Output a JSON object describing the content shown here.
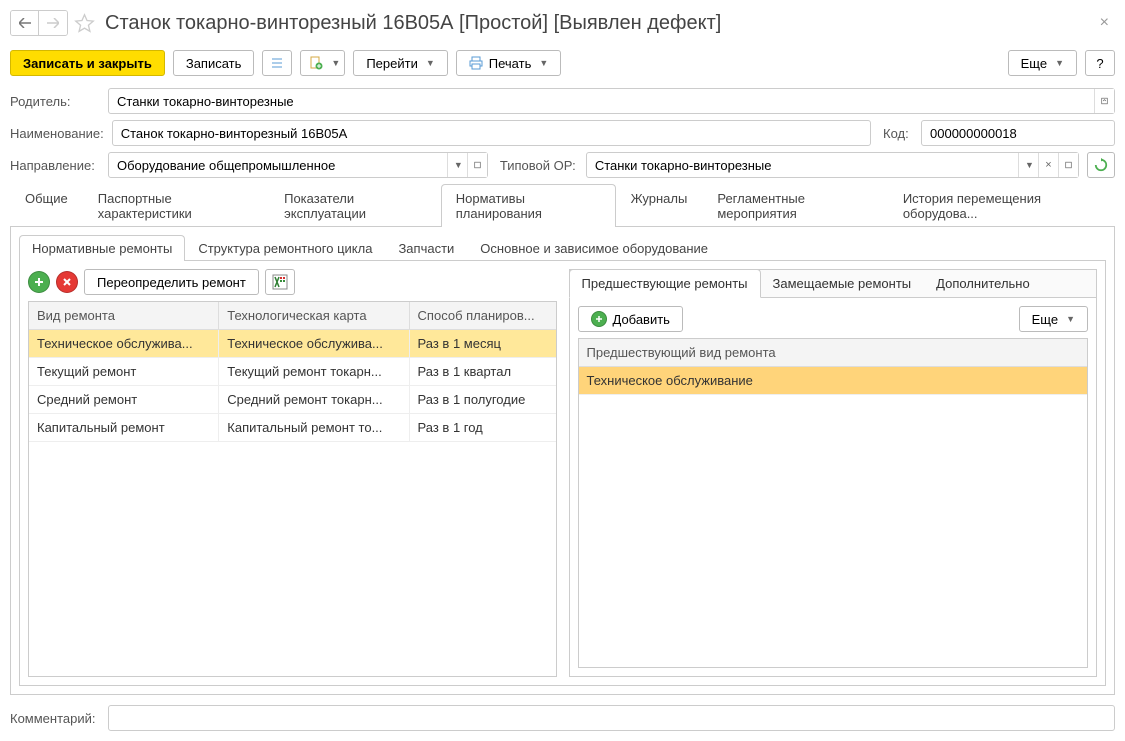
{
  "title": "Станок токарно-винторезный 16В05А [Простой] [Выявлен дефект]",
  "toolbar": {
    "save_close": "Записать и закрыть",
    "save": "Записать",
    "goto": "Перейти",
    "print": "Печать",
    "more": "Еще",
    "help": "?"
  },
  "form": {
    "parent_label": "Родитель:",
    "parent_value": "Станки токарно-винторезные",
    "name_label": "Наименование:",
    "name_value": "Станок токарно-винторезный 16В05А",
    "code_label": "Код:",
    "code_value": "000000000018",
    "direction_label": "Направление:",
    "direction_value": "Оборудование общепромышленное",
    "typeop_label": "Типовой ОР:",
    "typeop_value": "Станки токарно-винторезные"
  },
  "tabs": {
    "t0": "Общие",
    "t1": "Паспортные характеристики",
    "t2": "Показатели эксплуатации",
    "t3": "Нормативы планирования",
    "t4": "Журналы",
    "t5": "Регламентные мероприятия",
    "t6": "История перемещения оборудова..."
  },
  "subtabs": {
    "s0": "Нормативные ремонты",
    "s1": "Структура ремонтного цикла",
    "s2": "Запчасти",
    "s3": "Основное и зависимое оборудование"
  },
  "left": {
    "redefine": "Переопределить ремонт",
    "h0": "Вид ремонта",
    "h1": "Технологическая карта",
    "h2": "Способ планиров...",
    "rows": {
      "r0": {
        "c0": "Техническое обслужива...",
        "c1": "Техническое обслужива...",
        "c2": "Раз в 1 месяц"
      },
      "r1": {
        "c0": "Текущий ремонт",
        "c1": "Текущий ремонт токарн...",
        "c2": "Раз в 1 квартал"
      },
      "r2": {
        "c0": "Средний ремонт",
        "c1": "Средний ремонт токарн...",
        "c2": "Раз в 1 полугодие"
      },
      "r3": {
        "c0": "Капитальный ремонт",
        "c1": "Капитальный ремонт то...",
        "c2": "Раз в 1 год"
      }
    }
  },
  "right": {
    "tab0": "Предшествующие ремонты",
    "tab1": "Замещаемые ремонты",
    "tab2": "Дополнительно",
    "add": "Добавить",
    "more": "Еще",
    "h0": "Предшествующий вид ремонта",
    "row0": "Техническое обслуживание"
  },
  "comment_label": "Комментарий:"
}
